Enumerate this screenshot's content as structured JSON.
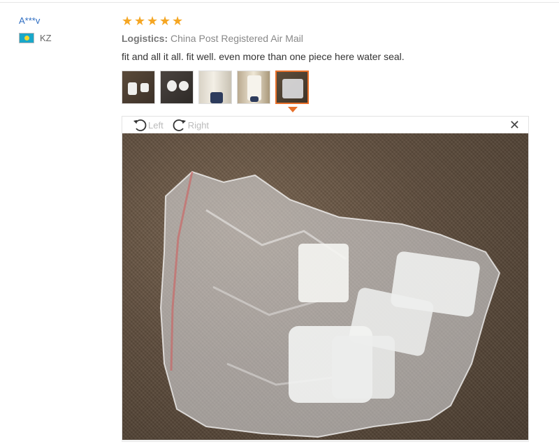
{
  "user": {
    "name": "A***v",
    "country_code": "KZ"
  },
  "review": {
    "rating": 5,
    "logistics_label": "Logistics:",
    "logistics_value": "China Post Registered Air Mail",
    "text": "fit and all it all. fit well. even more than one piece here water seal.",
    "thumbnail_count": 5,
    "selected_thumbnail": 5
  },
  "viewer": {
    "left_label": "Left",
    "right_label": "Right",
    "close_icon": "close-icon"
  },
  "colors": {
    "star": "#f5a623",
    "accent": "#e8702a",
    "link": "#2f6ec2"
  }
}
